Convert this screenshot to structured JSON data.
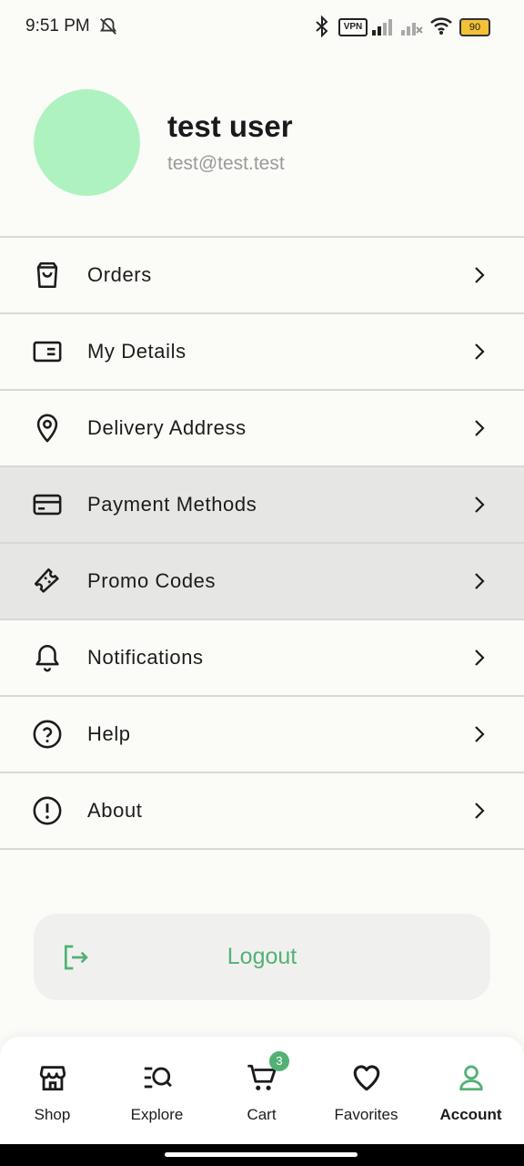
{
  "status_bar": {
    "time": "9:51 PM",
    "vpn_label": "VPN",
    "battery": "90",
    "icons": [
      "mute-icon",
      "bluetooth-icon",
      "vpn-icon",
      "signal-icon",
      "signal-no-service-icon",
      "wifi-icon",
      "battery-icon"
    ]
  },
  "profile": {
    "name": "test user",
    "email": "test@test.test",
    "avatar_color": "#aef2c0"
  },
  "menu": {
    "items": [
      {
        "label": "Orders",
        "icon": "shopping-bag-icon"
      },
      {
        "label": "My Details",
        "icon": "id-card-icon"
      },
      {
        "label": "Delivery Address",
        "icon": "location-pin-icon"
      },
      {
        "label": "Payment Methods",
        "icon": "credit-card-icon"
      },
      {
        "label": "Promo Codes",
        "icon": "ticket-icon"
      },
      {
        "label": "Notifications",
        "icon": "bell-icon"
      },
      {
        "label": "Help",
        "icon": "help-circle-icon"
      },
      {
        "label": "About",
        "icon": "info-circle-icon"
      }
    ]
  },
  "logout": {
    "label": "Logout",
    "icon": "logout-icon",
    "color": "#53b175"
  },
  "bottom_nav": {
    "items": [
      {
        "label": "Shop",
        "icon": "store-icon"
      },
      {
        "label": "Explore",
        "icon": "explore-search-icon"
      },
      {
        "label": "Cart",
        "icon": "cart-icon",
        "badge": "3"
      },
      {
        "label": "Favorites",
        "icon": "heart-icon"
      },
      {
        "label": "Account",
        "icon": "user-icon",
        "active": true
      }
    ],
    "accent_color": "#53b175"
  }
}
